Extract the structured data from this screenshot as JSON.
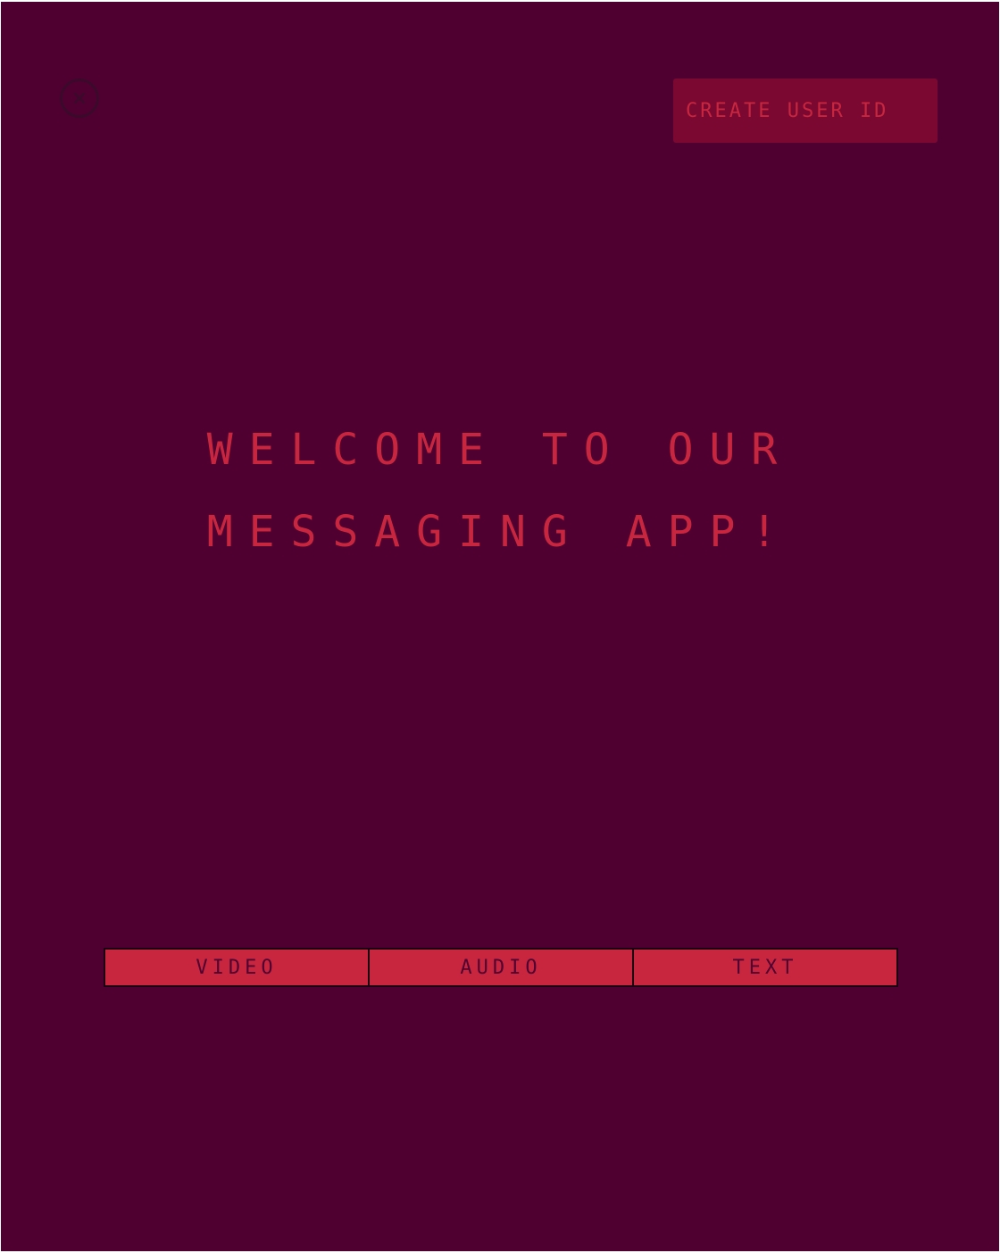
{
  "header": {
    "close_icon": "close-circle-icon",
    "create_user_label": "CREATE USER ID"
  },
  "welcome": {
    "line1": "WELCOME TO OUR",
    "line2": "MESSAGING APP!"
  },
  "tabs": [
    {
      "label": "VIDEO"
    },
    {
      "label": "AUDIO"
    },
    {
      "label": "TEXT"
    }
  ],
  "colors": {
    "background": "#4f0031",
    "accent": "#c8263f",
    "button_bg": "#7a0831",
    "border": "#1a0010"
  }
}
